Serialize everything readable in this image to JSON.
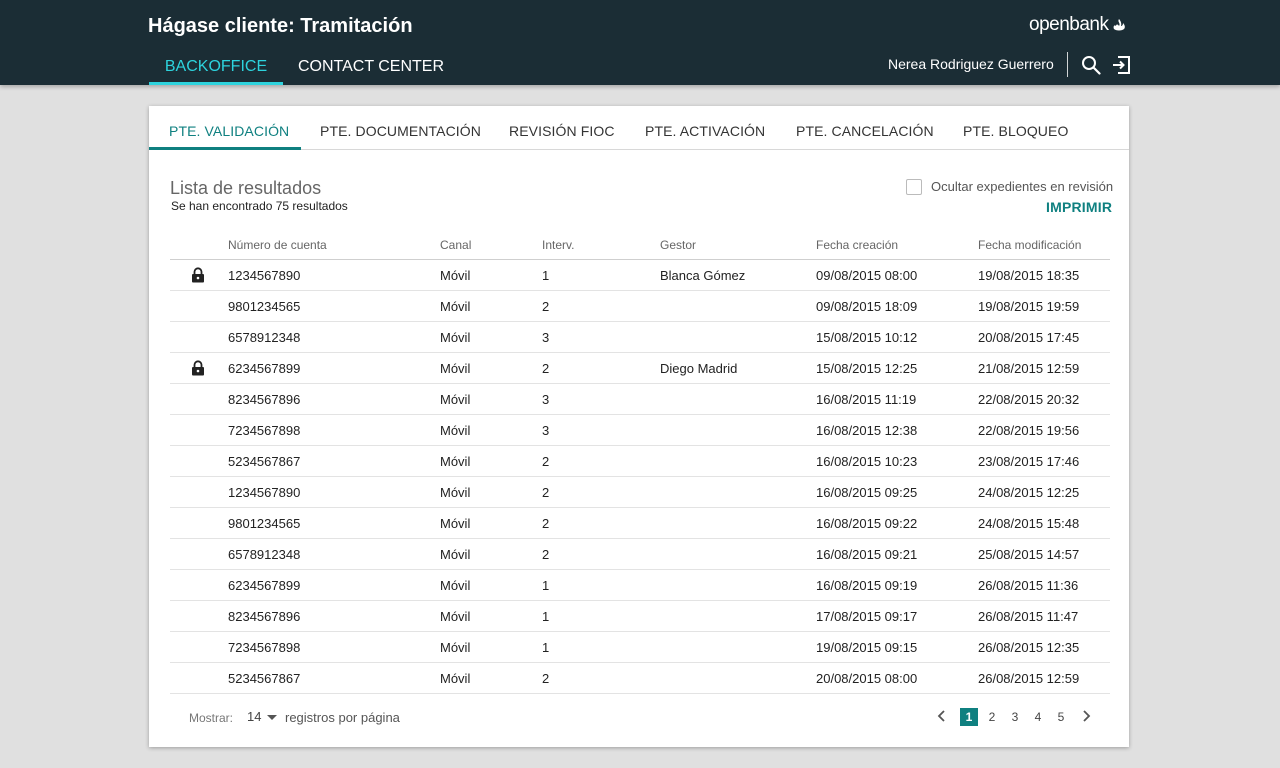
{
  "header": {
    "title": "Hágase cliente: Tramitación",
    "brand": "openbank",
    "nav": [
      {
        "label": "BACKOFFICE",
        "active": true
      },
      {
        "label": "CONTACT CENTER",
        "active": false
      }
    ],
    "user_name": "Nerea Rodriguez Guerrero",
    "icons": [
      "search-icon",
      "logout-icon"
    ],
    "colors": {
      "bar": "#1b2d35",
      "accent": "#2dd3dd"
    }
  },
  "tabs": [
    {
      "label": "PTE. VALIDACIÓN",
      "active": true
    },
    {
      "label": "PTE. DOCUMENTACIÓN",
      "active": false
    },
    {
      "label": "REVISIÓN FIOC",
      "active": false
    },
    {
      "label": "PTE. ACTIVACIÓN",
      "active": false
    },
    {
      "label": "PTE. CANCELACIÓN",
      "active": false
    },
    {
      "label": "PTE. BLOQUEO",
      "active": false
    }
  ],
  "results": {
    "title": "Lista de resultados",
    "count_text": "Se han encontrado 75 resultados",
    "hide_label": "Ocultar expedientes en revisión",
    "hide_checked": false,
    "print_label": "IMPRIMIR"
  },
  "table": {
    "columns": [
      "Número de cuenta",
      "Canal",
      "Interv.",
      "Gestor",
      "Fecha creación",
      "Fecha modificación"
    ],
    "rows": [
      {
        "locked": true,
        "account": "1234567890",
        "canal": "Móvil",
        "interv": "1",
        "gestor": "Blanca Gómez",
        "created": "09/08/2015  08:00",
        "modified": "19/08/2015  18:35"
      },
      {
        "locked": false,
        "account": "9801234565",
        "canal": "Móvil",
        "interv": "2",
        "gestor": "",
        "created": "09/08/2015  18:09",
        "modified": "19/08/2015  19:59"
      },
      {
        "locked": false,
        "account": "6578912348",
        "canal": "Móvil",
        "interv": "3",
        "gestor": "",
        "created": "15/08/2015  10:12",
        "modified": "20/08/2015  17:45"
      },
      {
        "locked": true,
        "account": "6234567899",
        "canal": "Móvil",
        "interv": "2",
        "gestor": "Diego Madrid",
        "created": "15/08/2015  12:25",
        "modified": "21/08/2015  12:59"
      },
      {
        "locked": false,
        "account": "8234567896",
        "canal": "Móvil",
        "interv": "3",
        "gestor": "",
        "created": "16/08/2015  11:19",
        "modified": "22/08/2015  20:32"
      },
      {
        "locked": false,
        "account": "7234567898",
        "canal": "Móvil",
        "interv": "3",
        "gestor": "",
        "created": "16/08/2015  12:38",
        "modified": "22/08/2015  19:56"
      },
      {
        "locked": false,
        "account": "5234567867",
        "canal": "Móvil",
        "interv": "2",
        "gestor": "",
        "created": "16/08/2015  10:23",
        "modified": "23/08/2015  17:46"
      },
      {
        "locked": false,
        "account": "1234567890",
        "canal": "Móvil",
        "interv": "2",
        "gestor": "",
        "created": "16/08/2015  09:25",
        "modified": "24/08/2015  12:25"
      },
      {
        "locked": false,
        "account": "9801234565",
        "canal": "Móvil",
        "interv": "2",
        "gestor": "",
        "created": "16/08/2015  09:22",
        "modified": "24/08/2015  15:48"
      },
      {
        "locked": false,
        "account": "6578912348",
        "canal": "Móvil",
        "interv": "2",
        "gestor": "",
        "created": "16/08/2015  09:21",
        "modified": "25/08/2015  14:57"
      },
      {
        "locked": false,
        "account": "6234567899",
        "canal": "Móvil",
        "interv": "1",
        "gestor": "",
        "created": "16/08/2015  09:19",
        "modified": "26/08/2015  11:36"
      },
      {
        "locked": false,
        "account": "8234567896",
        "canal": "Móvil",
        "interv": "1",
        "gestor": "",
        "created": "17/08/2015  09:17",
        "modified": "26/08/2015  11:47"
      },
      {
        "locked": false,
        "account": "7234567898",
        "canal": "Móvil",
        "interv": "1",
        "gestor": "",
        "created": "19/08/2015  09:15",
        "modified": "26/08/2015  12:35"
      },
      {
        "locked": false,
        "account": "5234567867",
        "canal": "Móvil",
        "interv": "2",
        "gestor": "",
        "created": "20/08/2015  08:00",
        "modified": "26/08/2015  12:59"
      }
    ]
  },
  "pagination": {
    "mostrar_label": "Mostrar:",
    "page_size": "14",
    "per_page_label": "registros por página",
    "pages": [
      "1",
      "2",
      "3",
      "4",
      "5"
    ],
    "current_page": "1"
  }
}
